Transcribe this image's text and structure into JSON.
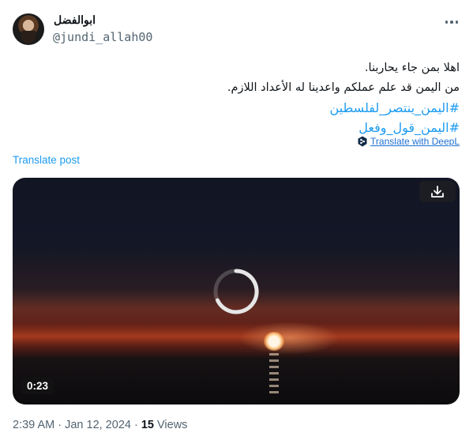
{
  "author": {
    "display_name": "ابوالفضل",
    "handle": "@jundi_allah00"
  },
  "tweet": {
    "lines": [
      "اهلا بمن جاء يحاربنا.",
      "من اليمن قد علم عملكم واعدينا له الأعداد اللازم."
    ],
    "hashtags": [
      "#اليمن_ينتصر_لفلسطين",
      "#اليمن_قول_وفعل"
    ],
    "deepl_label": "Translate with DeepL",
    "translate_label": "Translate post"
  },
  "video": {
    "duration": "0:23"
  },
  "meta": {
    "time": "2:39 AM",
    "separator": " · ",
    "date": "Jan 12, 2024",
    "views_count": "15",
    "views_label": " Views"
  },
  "icons": {
    "more": "more-horizontal-icon",
    "download": "download-icon",
    "deepl": "deepl-logo-icon",
    "spinner": "loading-spinner-icon"
  },
  "colors": {
    "link": "#1d9bf0",
    "secondary": "#536471"
  }
}
